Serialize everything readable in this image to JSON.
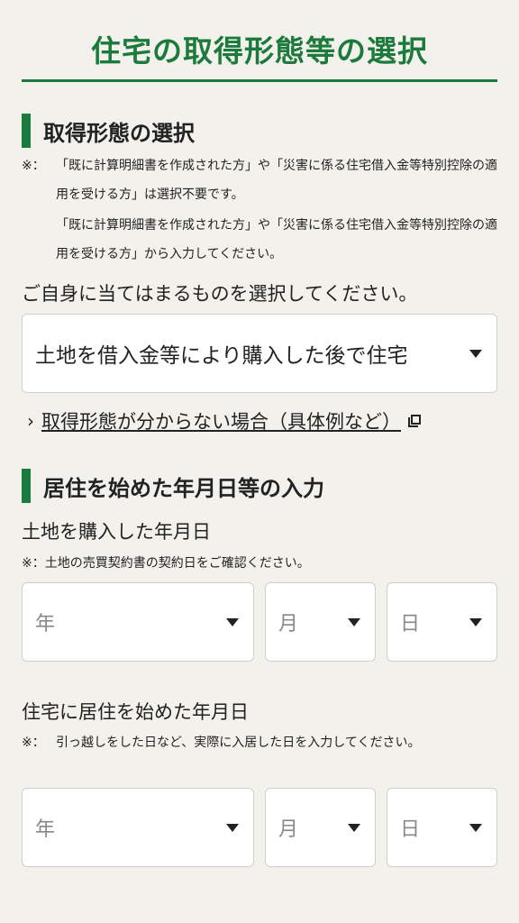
{
  "header": {
    "title": "住宅の取得形態等の選択"
  },
  "section1": {
    "heading": "取得形態の選択",
    "note_mark": "※：",
    "note1": "「既に計算明細書を作成された方」や「災害に係る住宅借入金等特別控除の適用を受ける方」は選択不要です。",
    "note2": "「既に計算明細書を作成された方」や「災害に係る住宅借入金等特別控除の適用を受ける方」から入力してください。",
    "prompt": "ご自身に当てはまるものを選択してください。",
    "select_value": "土地を借入金等により購入した後で住宅",
    "help_link": "取得形態が分からない場合（具体例など）"
  },
  "section2": {
    "heading": "居住を始めた年月日等の入力",
    "land": {
      "label": "土地を購入した年月日",
      "note": "※：土地の売買契約書の契約日をご確認ください。",
      "year": "年",
      "month": "月",
      "day": "日"
    },
    "residence": {
      "label": "住宅に居住を始めた年月日",
      "note_mark": "※：",
      "note": "引っ越しをした日など、実際に入居した日を入力してください。",
      "year": "年",
      "month": "月",
      "day": "日"
    }
  }
}
